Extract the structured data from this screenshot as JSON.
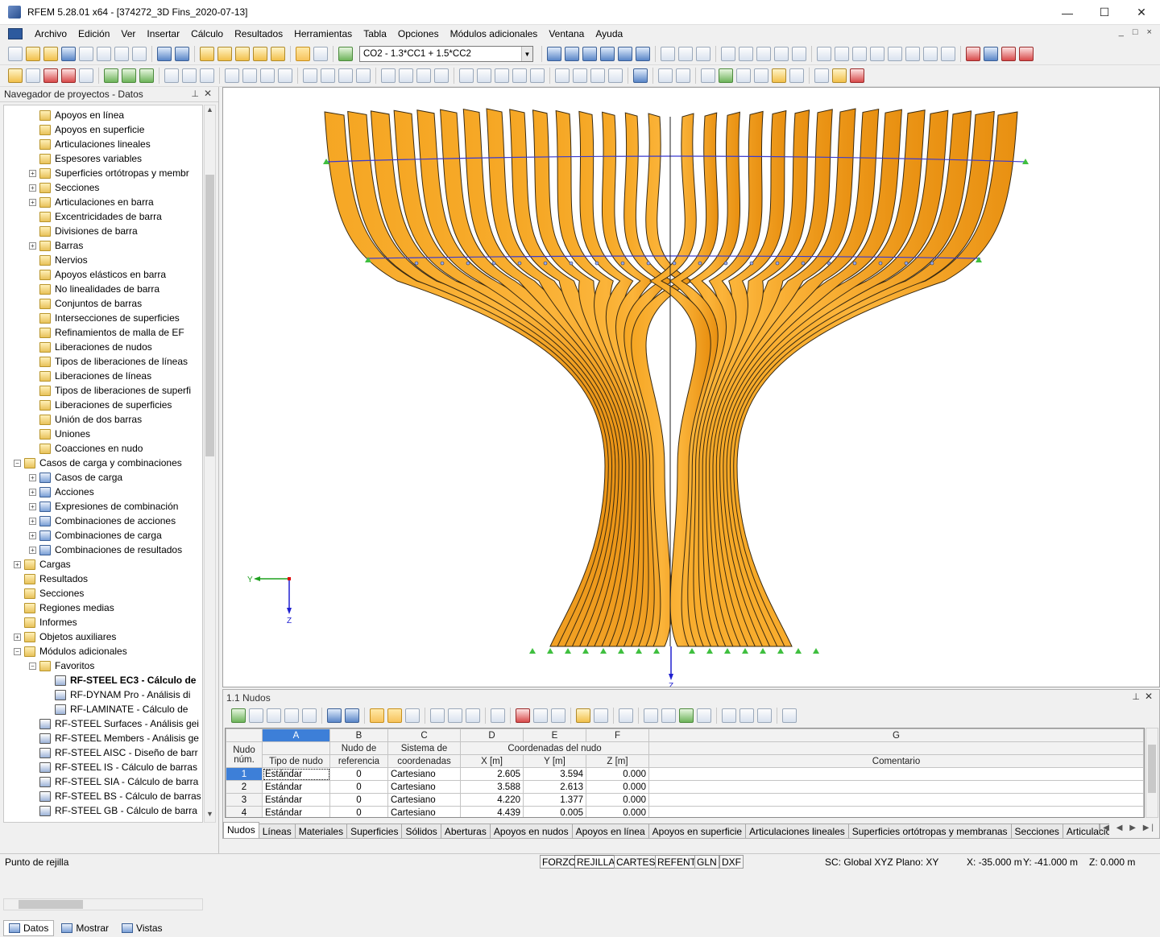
{
  "window": {
    "title": "RFEM 5.28.01 x64 - [374272_3D Fins_2020-07-13]"
  },
  "menu": [
    "Archivo",
    "Edición",
    "Ver",
    "Insertar",
    "Cálculo",
    "Resultados",
    "Herramientas",
    "Tabla",
    "Opciones",
    "Módulos adicionales",
    "Ventana",
    "Ayuda"
  ],
  "toolbar": {
    "load_combo": "CO2 - 1.3*CC1 + 1.5*CC2"
  },
  "navigator": {
    "title": "Navegador de proyectos - Datos",
    "items": [
      {
        "label": "Apoyos en línea",
        "level": 3,
        "exp": false
      },
      {
        "label": "Apoyos en superficie",
        "level": 3,
        "exp": false
      },
      {
        "label": "Articulaciones lineales",
        "level": 3,
        "exp": false
      },
      {
        "label": "Espesores variables",
        "level": 3,
        "exp": false
      },
      {
        "label": "Superficies ortótropas y membr",
        "level": 3,
        "exp": true
      },
      {
        "label": "Secciones",
        "level": 3,
        "exp": true
      },
      {
        "label": "Articulaciones en barra",
        "level": 3,
        "exp": true
      },
      {
        "label": "Excentricidades de barra",
        "level": 3,
        "exp": false
      },
      {
        "label": "Divisiones de barra",
        "level": 3,
        "exp": false
      },
      {
        "label": "Barras",
        "level": 3,
        "exp": true
      },
      {
        "label": "Nervios",
        "level": 3,
        "exp": false
      },
      {
        "label": "Apoyos elásticos en barra",
        "level": 3,
        "exp": false
      },
      {
        "label": "No linealidades de barra",
        "level": 3,
        "exp": false
      },
      {
        "label": "Conjuntos de barras",
        "level": 3,
        "exp": false
      },
      {
        "label": "Intersecciones de superficies",
        "level": 3,
        "exp": false
      },
      {
        "label": "Refinamientos de malla de EF",
        "level": 3,
        "exp": false
      },
      {
        "label": "Liberaciones de nudos",
        "level": 3,
        "exp": false
      },
      {
        "label": "Tipos de liberaciones de líneas",
        "level": 3,
        "exp": false
      },
      {
        "label": "Liberaciones de líneas",
        "level": 3,
        "exp": false
      },
      {
        "label": "Tipos de liberaciones de superfi",
        "level": 3,
        "exp": false
      },
      {
        "label": "Liberaciones de superficies",
        "level": 3,
        "exp": false
      },
      {
        "label": "Unión de dos barras",
        "level": 3,
        "exp": false
      },
      {
        "label": "Uniones",
        "level": 3,
        "exp": false
      },
      {
        "label": "Coacciones en nudo",
        "level": 3,
        "exp": false
      },
      {
        "label": "Casos de carga y combinaciones",
        "level": 2,
        "exp": true,
        "open": true
      },
      {
        "label": "Casos de carga",
        "level": 3,
        "exp": true,
        "blue": true
      },
      {
        "label": "Acciones",
        "level": 3,
        "exp": true,
        "blue": true
      },
      {
        "label": "Expresiones de combinación",
        "level": 3,
        "exp": true,
        "blue": true
      },
      {
        "label": "Combinaciones de acciones",
        "level": 3,
        "exp": true,
        "blue": true
      },
      {
        "label": "Combinaciones de carga",
        "level": 3,
        "exp": true,
        "blue": true
      },
      {
        "label": "Combinaciones de resultados",
        "level": 3,
        "exp": true,
        "blue": true
      },
      {
        "label": "Cargas",
        "level": 2,
        "exp": true
      },
      {
        "label": "Resultados",
        "level": 2,
        "exp": false
      },
      {
        "label": "Secciones",
        "level": 2,
        "exp": false
      },
      {
        "label": "Regiones medias",
        "level": 2,
        "exp": false
      },
      {
        "label": "Informes",
        "level": 2,
        "exp": false
      },
      {
        "label": "Objetos auxiliares",
        "level": 2,
        "exp": true
      },
      {
        "label": "Módulos adicionales",
        "level": 2,
        "exp": true,
        "open": true
      },
      {
        "label": "Favoritos",
        "level": 3,
        "exp": true,
        "open": true
      },
      {
        "label": "RF-STEEL EC3 - Cálculo de",
        "level": 4,
        "exp": false,
        "mod": true,
        "bold": true
      },
      {
        "label": "RF-DYNAM Pro - Análisis di",
        "level": 4,
        "exp": false,
        "mod": true
      },
      {
        "label": "RF-LAMINATE - Cálculo de",
        "level": 4,
        "exp": false,
        "mod": true
      },
      {
        "label": "RF-STEEL Surfaces - Análisis gei",
        "level": 3,
        "exp": false,
        "mod": true
      },
      {
        "label": "RF-STEEL Members - Análisis ge",
        "level": 3,
        "exp": false,
        "mod": true
      },
      {
        "label": "RF-STEEL AISC - Diseño de barr",
        "level": 3,
        "exp": false,
        "mod": true
      },
      {
        "label": "RF-STEEL IS - Cálculo de barras",
        "level": 3,
        "exp": false,
        "mod": true
      },
      {
        "label": "RF-STEEL SIA - Cálculo de barra",
        "level": 3,
        "exp": false,
        "mod": true
      },
      {
        "label": "RF-STEEL BS - Cálculo de barras",
        "level": 3,
        "exp": false,
        "mod": true
      },
      {
        "label": "RF-STEEL GB - Cálculo de barra",
        "level": 3,
        "exp": false,
        "mod": true
      }
    ],
    "tabs": [
      "Datos",
      "Mostrar",
      "Vistas"
    ]
  },
  "view": {
    "axis_y": "Y",
    "axis_z": "Z",
    "axis_z2": "Z"
  },
  "table": {
    "title": "1.1 Nudos",
    "col_letters": [
      "A",
      "B",
      "C",
      "D",
      "E",
      "F",
      "G"
    ],
    "h_nudo": "Nudo",
    "h_num": "núm.",
    "h_tipo": "Tipo de nudo",
    "h_ref1": "Nudo de",
    "h_ref2": "referencia",
    "h_sis1": "Sistema de",
    "h_sis2": "coordenadas",
    "h_coord": "Coordenadas del nudo",
    "h_x": "X [m]",
    "h_y": "Y [m]",
    "h_z": "Z [m]",
    "h_com": "Comentario",
    "rows": [
      {
        "n": "1",
        "tipo": "Estándar",
        "ref": "0",
        "sis": "Cartesiano",
        "x": "2.605",
        "y": "3.594",
        "z": "0.000"
      },
      {
        "n": "2",
        "tipo": "Estándar",
        "ref": "0",
        "sis": "Cartesiano",
        "x": "3.588",
        "y": "2.613",
        "z": "0.000"
      },
      {
        "n": "3",
        "tipo": "Estándar",
        "ref": "0",
        "sis": "Cartesiano",
        "x": "4.220",
        "y": "1.377",
        "z": "0.000"
      },
      {
        "n": "4",
        "tipo": "Estándar",
        "ref": "0",
        "sis": "Cartesiano",
        "x": "4.439",
        "y": "0.005",
        "z": "0.000"
      }
    ],
    "tabs": [
      "Nudos",
      "Líneas",
      "Materiales",
      "Superficies",
      "Sólidos",
      "Aberturas",
      "Apoyos en nudos",
      "Apoyos en línea",
      "Apoyos en superficie",
      "Articulaciones lineales",
      "Superficies ortótropas y membranas",
      "Secciones",
      "Articulaciones en barra"
    ]
  },
  "status": {
    "left": "Punto de rejilla",
    "buttons": [
      "FORZC",
      "REJILLA",
      "CARTES",
      "REFENT",
      "GLN",
      "DXF"
    ],
    "sc": "SC: Global XYZ",
    "plano": "Plano: XY",
    "x": "X:  -35.000 m",
    "y": "Y:  -41.000 m",
    "z": "Z:   0.000 m"
  }
}
